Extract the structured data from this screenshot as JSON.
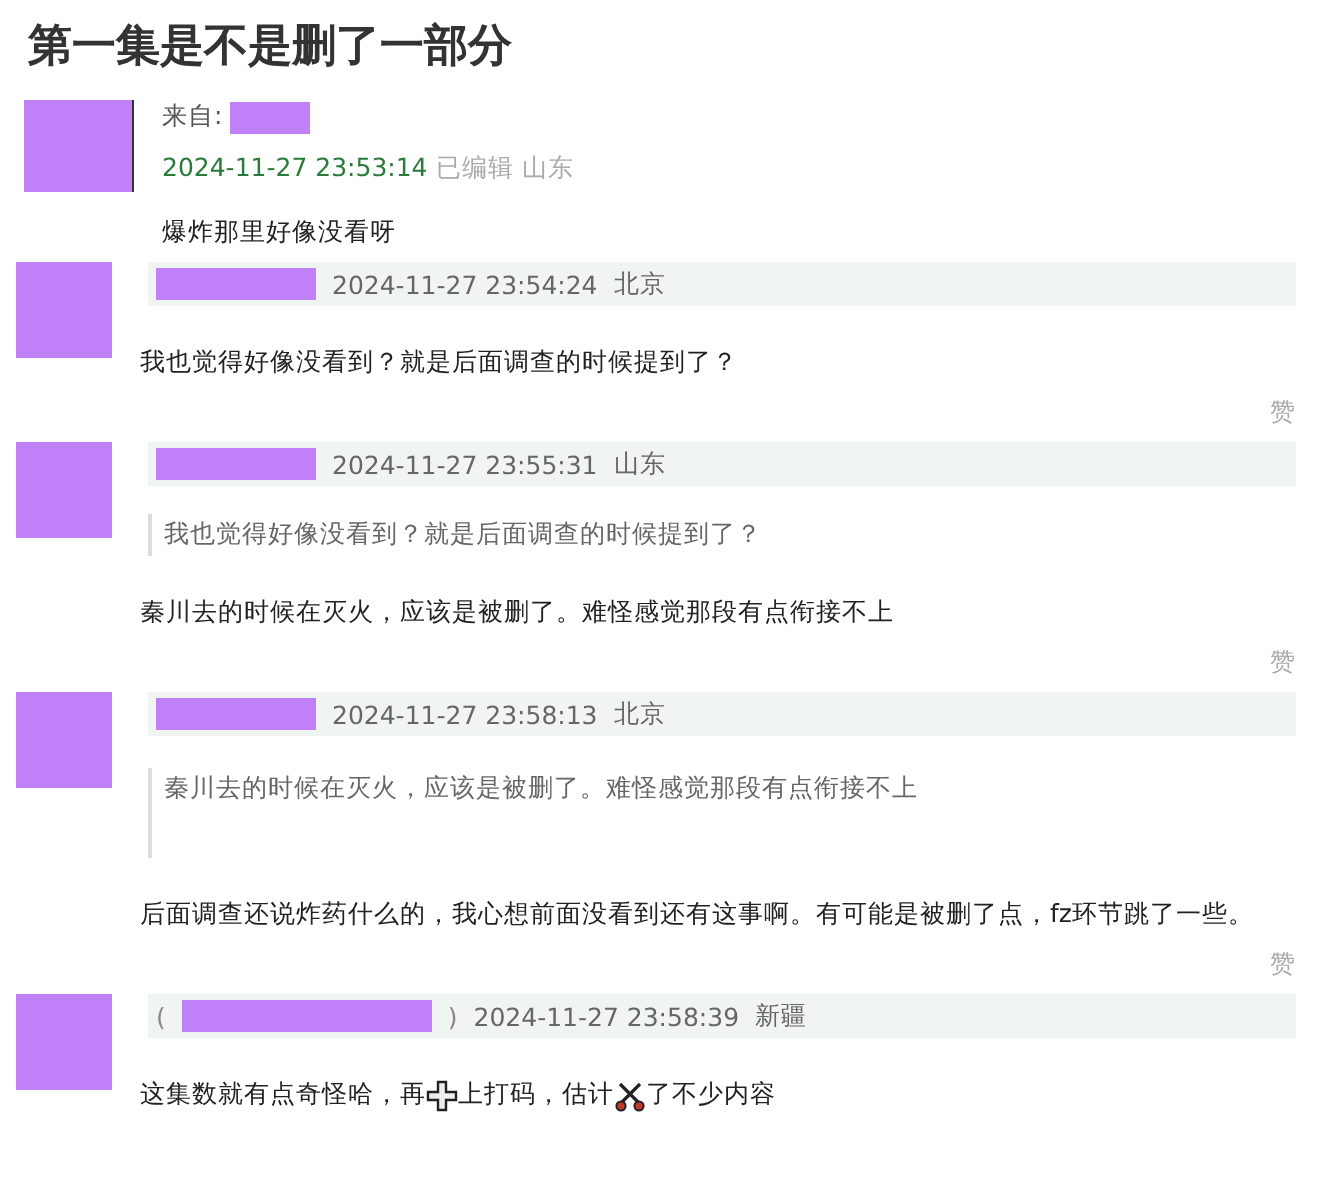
{
  "title": "第一集是不是删了一部分",
  "post": {
    "from_label": "来自:",
    "time": "2024-11-27 23:53:14",
    "edited": "已编辑",
    "location": "山东",
    "body": "爆炸那里好像没看呀"
  },
  "replies": [
    {
      "time": "2024-11-27 23:54:24",
      "location": "北京",
      "body": "我也觉得好像没看到？就是后面调查的时候提到了？",
      "like": "赞"
    },
    {
      "time": "2024-11-27 23:55:31",
      "location": "山东",
      "quote": "我也觉得好像没看到？就是后面调查的时候提到了？",
      "body": "秦川去的时候在灭火，应该是被删了。难怪感觉那段有点衔接不上",
      "like": "赞"
    },
    {
      "time": "2024-11-27 23:58:13",
      "location": "北京",
      "quote": "秦川去的时候在灭火，应该是被删了。难怪感觉那段有点衔接不上",
      "body": "后面调查还说炸药什么的，我心想前面没看到还有这事啊。有可能是被删了点，fz环节跳了一些。",
      "like": "赞"
    },
    {
      "time": "2024-11-27 23:58:39",
      "location": "新疆",
      "name_prefix": "(",
      "name_suffix": ")",
      "body_parts": [
        {
          "kind": "text",
          "text": "这集数就有点奇怪哈，再"
        },
        {
          "kind": "plus"
        },
        {
          "kind": "text",
          "text": "上打码，估计"
        },
        {
          "kind": "scissors"
        },
        {
          "kind": "text",
          "text": "了不少内容"
        }
      ]
    }
  ]
}
